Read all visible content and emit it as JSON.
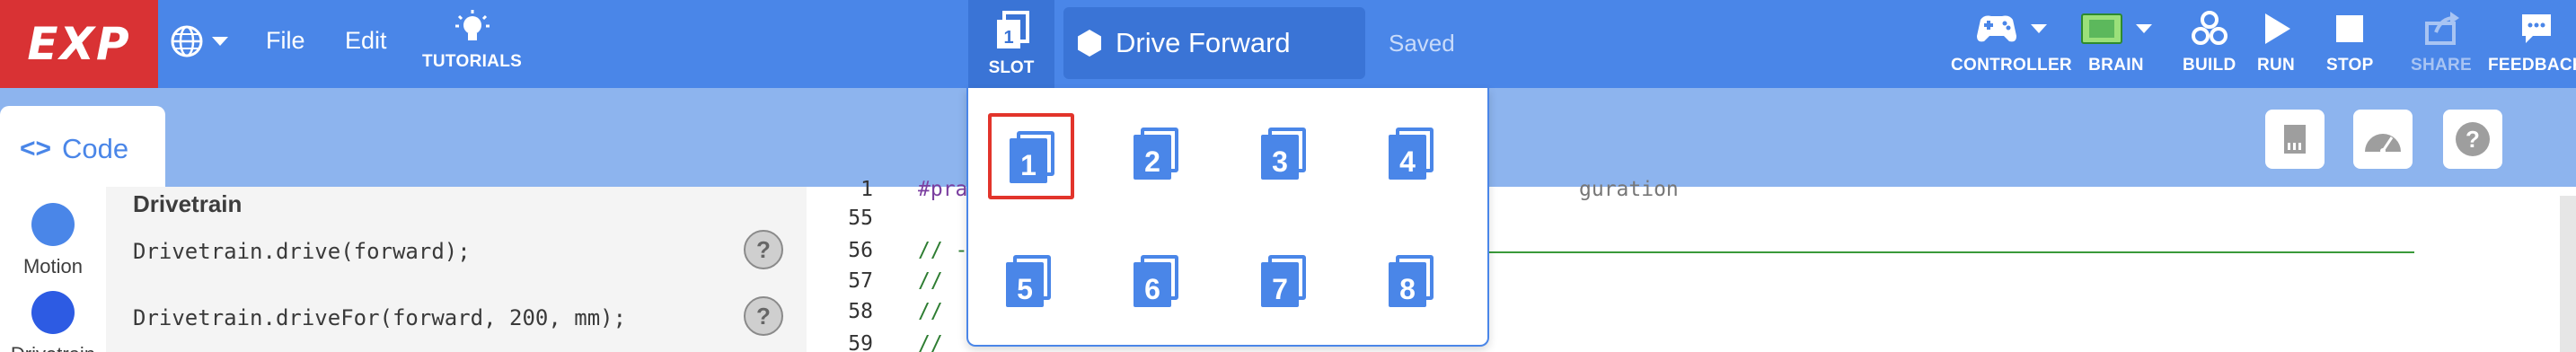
{
  "topbar": {
    "logo": "EXP",
    "menu": {
      "file": "File",
      "edit": "Edit"
    },
    "tutorials_label": "TUTORIALS",
    "slot_label": "SLOT",
    "slot_number": "1",
    "project_name": "Drive Forward",
    "save_status": "Saved",
    "right_buttons": {
      "controller": "CONTROLLER",
      "brain": "BRAIN",
      "build": "BUILD",
      "run": "RUN",
      "stop": "STOP",
      "share": "SHARE",
      "feedback": "FEEDBACK"
    }
  },
  "tabs": {
    "code": {
      "icon": "<>",
      "label": "Code"
    }
  },
  "categories": [
    {
      "label": "Motion",
      "color": "#4a86e8"
    },
    {
      "label": "Drivetrain",
      "color": "#2d5be3"
    }
  ],
  "blocks": {
    "header": "Drivetrain",
    "items": [
      "Drivetrain.drive(forward);",
      "Drivetrain.driveFor(forward, 200, mm);"
    ],
    "help_symbol": "?"
  },
  "editor": {
    "lines": [
      {
        "num": "1",
        "text": "#pra"
      },
      {
        "num": "55",
        "text": ""
      },
      {
        "num": "56",
        "text": "// -"
      },
      {
        "num": "57",
        "text": "//"
      },
      {
        "num": "58",
        "text": "//"
      },
      {
        "num": "59",
        "text": "//"
      }
    ],
    "line1_right_fragment": "guration"
  },
  "slots": {
    "selected": "1",
    "items": [
      "1",
      "2",
      "3",
      "4",
      "5",
      "6",
      "7",
      "8"
    ]
  },
  "colors": {
    "primary": "#4a86e8",
    "logo_red": "#d93234",
    "selected_outline": "#e2342b"
  }
}
